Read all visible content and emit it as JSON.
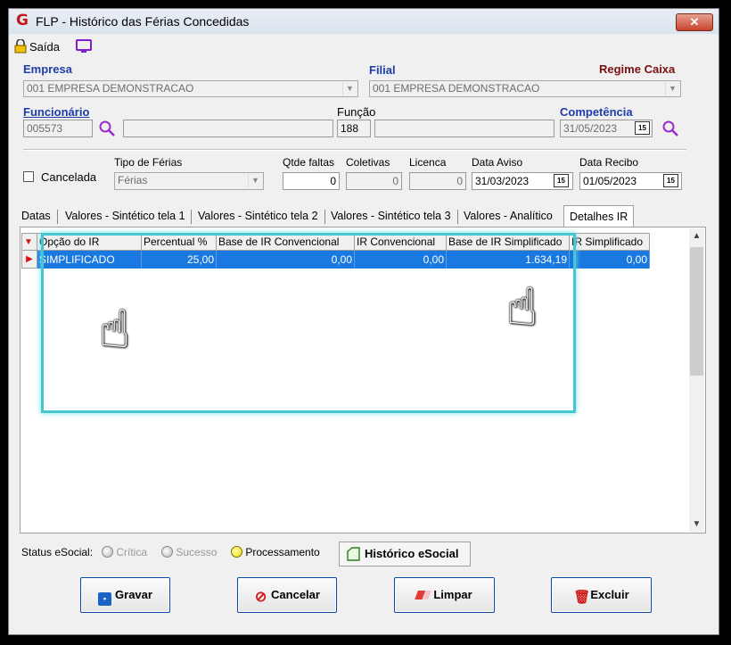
{
  "window": {
    "title": "FLP - Histórico das Férias Concedidas",
    "app_icon": "G",
    "close_glyph": "✕"
  },
  "toolbar": {
    "exit_label": "Saída"
  },
  "empresa": {
    "label": "Empresa",
    "value": "001 EMPRESA DEMONSTRACAO"
  },
  "filial": {
    "label": "Filial",
    "value": "001 EMPRESA DEMONSTRACAO"
  },
  "regime": {
    "label": "Regime Caixa"
  },
  "funcionario": {
    "label": "Funcionário",
    "code": "005573",
    "name": ""
  },
  "funcao": {
    "label": "Função",
    "code": "188",
    "name": ""
  },
  "competencia": {
    "label": "Competência",
    "value": "31/05/2023"
  },
  "ferias": {
    "cancelada_label": "Cancelada",
    "tipo_label": "Tipo de Férias",
    "tipo_value": "Férias",
    "faltas_label": "Qtde faltas",
    "faltas_value": "0",
    "coletivas_label": "Coletivas",
    "coletivas_value": "0",
    "licenca_label": "Licenca",
    "licenca_value": "0",
    "aviso_label": "Data Aviso",
    "aviso_value": "31/03/2023",
    "recibo_label": "Data Recibo",
    "recibo_value": "01/05/2023",
    "cal_glyph": "15"
  },
  "tabs": [
    {
      "label": "Datas"
    },
    {
      "label": "Valores - Sintético tela 1"
    },
    {
      "label": "Valores - Sintético tela 2"
    },
    {
      "label": "Valores - Sintético tela 3"
    },
    {
      "label": "Valores - Analítico"
    },
    {
      "label": "Detalhes IR"
    }
  ],
  "grid": {
    "columns": [
      "Opção do IR",
      "Percentual %",
      "Base de IR Convencional",
      "IR Convencional",
      "Base de IR Simplificado",
      "IR Simplificado"
    ],
    "rows": [
      [
        "SIMPLIFICADO",
        "25,00",
        "0,00",
        "0,00",
        "1.634,19",
        "0,00"
      ]
    ],
    "selected_row": 0
  },
  "status": {
    "label": "Status eSocial:",
    "critica": "Crítica",
    "sucesso": "Sucesso",
    "processamento": "Processamento",
    "historico_button": "Histórico eSocial"
  },
  "actions": {
    "gravar": "Gravar",
    "cancelar": "Cancelar",
    "limpar": "Limpar",
    "excluir": "Excluir"
  }
}
